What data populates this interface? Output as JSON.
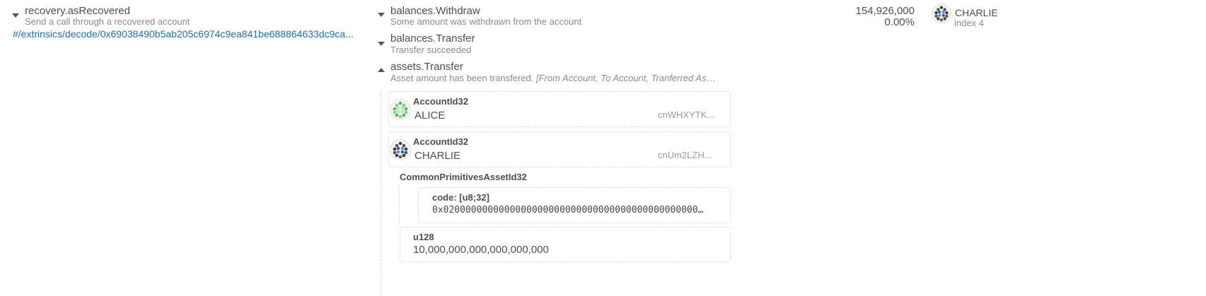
{
  "extrinsic": {
    "title": "recovery.asRecovered",
    "description": "Send a call through a recovered account",
    "decode_link": "#/extrinsics/decode/0x69038490b5ab205c6974c9ea841be688864633dc9ca..."
  },
  "events": [
    {
      "title": "balances.Withdraw",
      "description": "Some amount was withdrawn from the account",
      "expanded": false
    },
    {
      "title": "balances.Transfer",
      "description": "Transfer succeeded",
      "expanded": false
    },
    {
      "title": "assets.Transfer",
      "description": "Asset amount has been transfered.",
      "params_hint": "[From Account, To Account, Tranferred Asset Id,...",
      "expanded": true
    }
  ],
  "transfer_params": {
    "from": {
      "type": "AccountId32",
      "name": "ALICE",
      "address": "cnWHXYTK..."
    },
    "to": {
      "type": "AccountId32",
      "name": "CHARLIE",
      "address": "cnUm2LZH..."
    },
    "asset": {
      "type": "CommonPrimitivesAssetId32",
      "code_label": "code: [u8;32]",
      "code_value": "0x0200000000000000000000000000000000000000000000000..."
    },
    "amount": {
      "type": "u128",
      "value": "10,000,000,000,000,000,000"
    }
  },
  "fee": {
    "weight": "154,926,000",
    "percent": "0.00%"
  },
  "signer": {
    "name": "CHARLIE",
    "index": "index 4"
  },
  "icons": {
    "caret": "chevron-down-icon",
    "alice_identicon": "identicon-green",
    "charlie_identicon": "identicon-blue"
  },
  "colors": {
    "link": "#1f6fa8",
    "alice": "#58b85c",
    "charlie": "#3f5aa8"
  }
}
